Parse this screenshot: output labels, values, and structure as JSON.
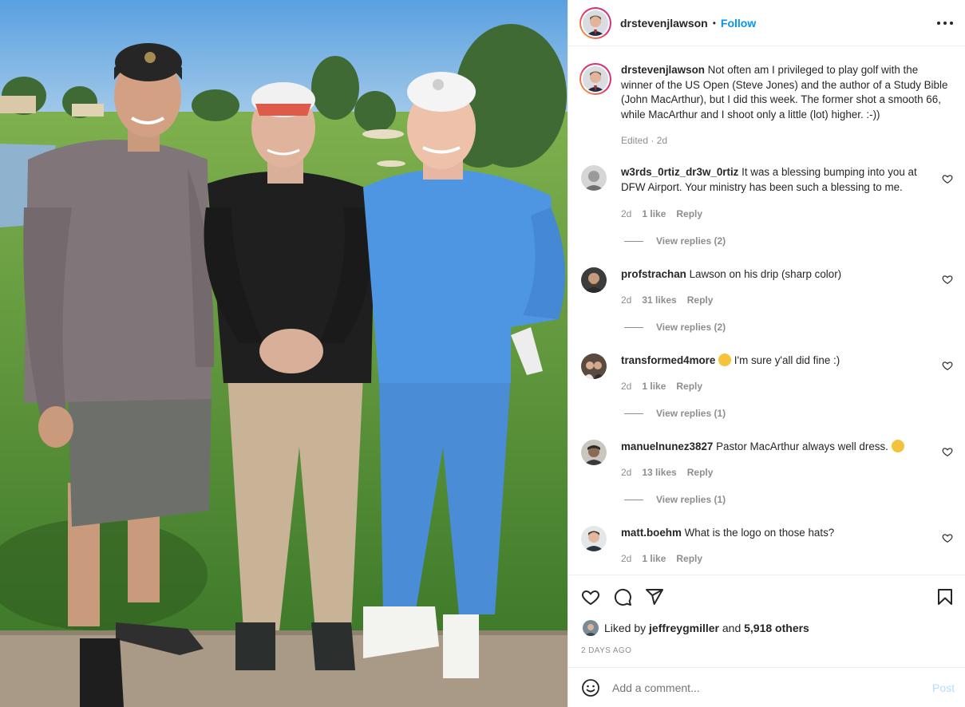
{
  "post": {
    "username": "drstevenjlawson",
    "separator": "•",
    "follow_label": "Follow",
    "more_icon": "more-horizontal-icon",
    "caption": "Not often am I privileged to play golf with the winner of the US Open (Steve Jones) and the author of a Study Bible (John MacArthur), but I did this week. The former shot a smooth 66, while MacArthur and I shoot only a little (lot) higher. :-))",
    "caption_meta": "Edited · 2d"
  },
  "comments": [
    {
      "username": "w3rds_0rtiz_dr3w_0rtiz",
      "text": "It was a blessing bumping into you at DFW Airport. Your ministry has been such a blessing to me.",
      "age": "2d",
      "likes": "1 like",
      "reply": "Reply",
      "view_replies": "View replies (2)"
    },
    {
      "username": "profstrachan",
      "text": "Lawson on his drip (sharp color)",
      "age": "2d",
      "likes": "31 likes",
      "reply": "Reply",
      "view_replies": "View replies (2)"
    },
    {
      "username": "transformed4more",
      "text": "I'm sure y'all did fine :)",
      "age": "2d",
      "likes": "1 like",
      "reply": "Reply",
      "view_replies": "View replies (1)"
    },
    {
      "username": "manuelnunez3827",
      "text": "Pastor MacArthur always well dress.",
      "age": "2d",
      "likes": "13 likes",
      "reply": "Reply",
      "view_replies": "View replies (1)"
    },
    {
      "username": "matt.boehm",
      "text": "What is the logo on those hats?",
      "age": "2d",
      "likes": "1 like",
      "reply": "Reply"
    }
  ],
  "actions": {
    "icons": [
      "heart-icon",
      "comment-icon",
      "share-icon",
      "bookmark-icon"
    ],
    "liked_prefix": "Liked by",
    "liked_user": "jeffreygmiller",
    "liked_and": "and",
    "liked_others": "5,918 others",
    "timestamp": "2 DAYS AGO",
    "comment_placeholder": "Add a comment...",
    "post_label": "Post"
  },
  "colors": {
    "accent": "#0095f6",
    "post_disabled": "#b2dffc",
    "muted": "#8e8e8e",
    "text": "#262626"
  }
}
